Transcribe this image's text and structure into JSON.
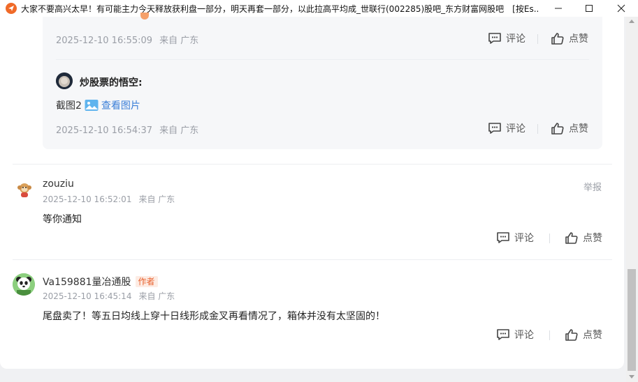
{
  "window": {
    "title": "大家不要高兴太早！有可能主力今天释放获利盘一部分，明天再套一部分，以此拉高平均成_世联行(002285)股吧_东方财富网股吧　[按Es..."
  },
  "actions": {
    "comment_label": "评论",
    "like_label": "点赞",
    "report_label": "举报"
  },
  "replies": [
    {
      "time": "2025-12-10 16:55:09",
      "location": "来自 广东"
    },
    {
      "author": "炒股票的悟空:",
      "text": "截图2",
      "view_image_label": "查看图片",
      "time": "2025-12-10 16:54:37",
      "location": "来自 广东"
    }
  ],
  "posts": [
    {
      "username": "zouziu",
      "time": "2025-12-10 16:52:01",
      "location": "来自 广东",
      "text": "等你通知"
    },
    {
      "username": "Va159881量冶通股",
      "badge": "作者",
      "time": "2025-12-10 16:45:14",
      "location": "来自 广东",
      "text": "尾盘卖了！等五日均线上穿十日线形成金叉再看情况了，箱体并没有太坚固的！"
    }
  ],
  "colors": {
    "accent_orange": "#f06a28",
    "link_blue": "#3b7fd8",
    "badge_orange": "#e8602c"
  }
}
